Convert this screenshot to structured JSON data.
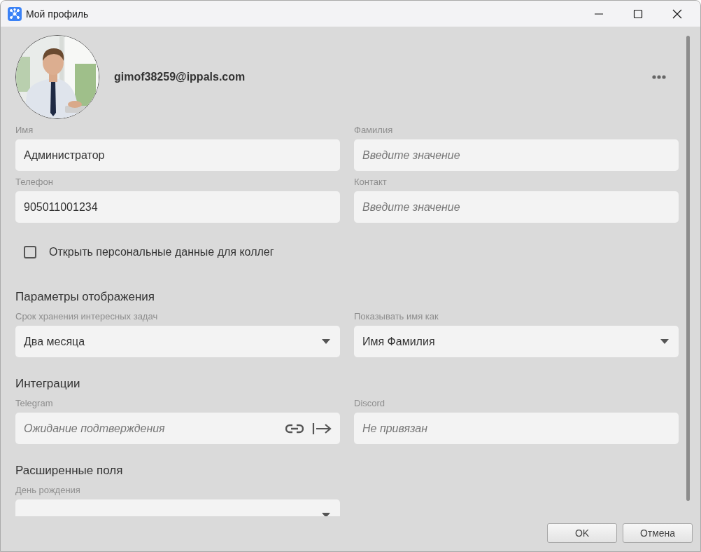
{
  "window": {
    "title": "Мой профиль"
  },
  "profile": {
    "email": "gimof38259@ippals.com"
  },
  "personal_fields": [
    {
      "label": "Имя",
      "value": "Администратор"
    },
    {
      "label": "Фамилия",
      "placeholder": "Введите значение"
    },
    {
      "label": "Телефон",
      "value": "905011001234"
    },
    {
      "label": "Контакт",
      "placeholder": "Введите значение"
    }
  ],
  "share_checkbox": {
    "label": "Открыть персональные данные для коллег",
    "checked": false
  },
  "sections": [
    {
      "title": "Параметры отображения",
      "fields": [
        {
          "kind": "select",
          "label": "Срок хранения интересных задач",
          "value": "Два месяца"
        },
        {
          "kind": "select",
          "label": "Показывать имя как",
          "value": "Имя Фамилия"
        }
      ]
    },
    {
      "title": "Интеграции",
      "fields": [
        {
          "kind": "link",
          "label": "Telegram",
          "placeholder": "Ожидание подтверждения"
        },
        {
          "kind": "text",
          "label": "Discord",
          "placeholder": "Не привязан"
        }
      ]
    },
    {
      "title": "Расширенные поля",
      "fields": [
        {
          "kind": "select",
          "label": "День рождения"
        }
      ]
    }
  ],
  "buttons": [
    "OK",
    "Отмена"
  ]
}
